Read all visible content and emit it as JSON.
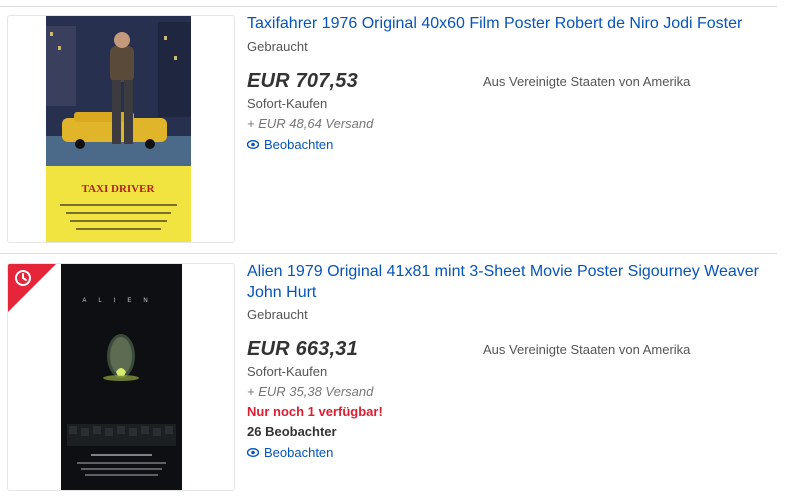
{
  "listings": [
    {
      "title": "Taxifahrer 1976 Original 40x60 Film Poster Robert de Niro Jodi Foster",
      "condition": "Gebraucht",
      "price": "EUR 707,53",
      "buy_format": "Sofort-Kaufen",
      "shipping": "+ EUR 48,64 Versand",
      "origin": "Aus Vereinigte Staaten von Amerika",
      "watch_label": "Beobachten",
      "poster_title": "TAXI DRIVER",
      "icon": "eye-icon"
    },
    {
      "title": "Alien 1979 Original 41x81 mint 3-Sheet Movie Poster Sigourney Weaver John Hurt",
      "condition": "Gebraucht",
      "price": "EUR 663,31",
      "buy_format": "Sofort-Kaufen",
      "shipping": "+ EUR 35,38 Versand",
      "origin": "Aus Vereinigte Staaten von Amerika",
      "availability": "Nur noch 1 verfügbar!",
      "watchers": "26 Beobachter",
      "watch_label": "Beobachten",
      "poster_title": "ALIEN",
      "badge_icon": "clock-icon",
      "badge_color": "#e4253a",
      "icon": "eye-icon"
    }
  ],
  "colors": {
    "link": "#0654ba",
    "alert": "#dd1e31"
  }
}
